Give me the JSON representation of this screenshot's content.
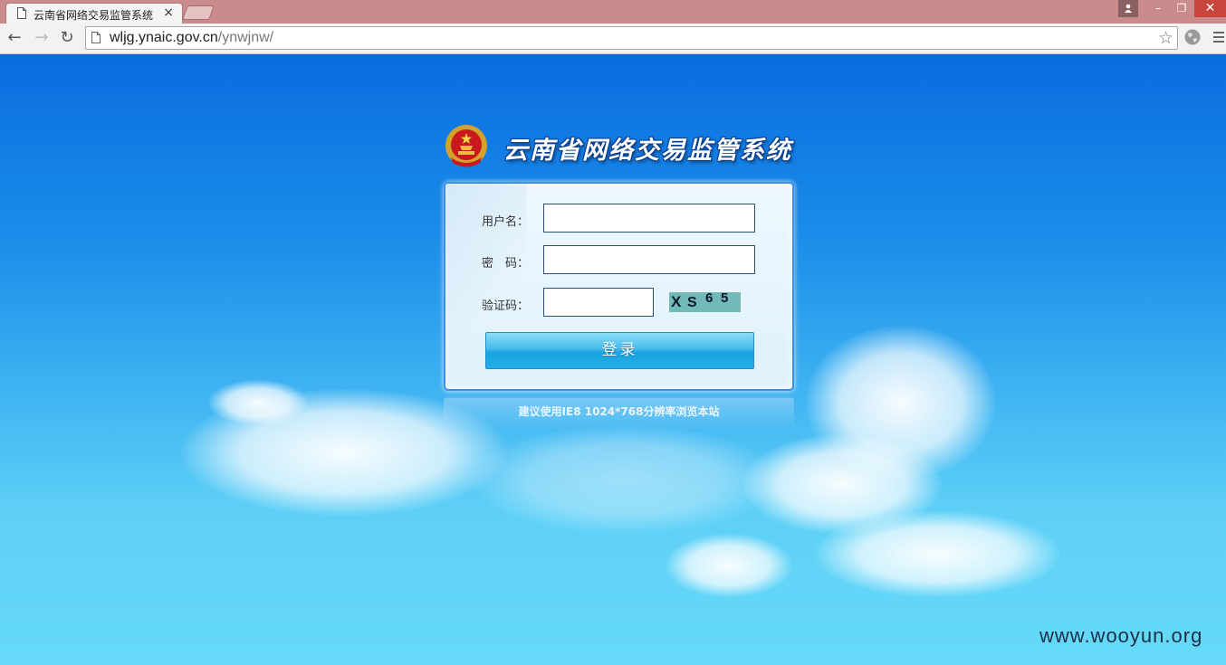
{
  "browser": {
    "tab_title": "云南省网络交易监管系统",
    "tab_close": "×",
    "url_host": "wljg.ynaic.gov.cn",
    "url_path": "/ynwjnw/",
    "window_buttons": {
      "minimize": "–",
      "maximize": "❐",
      "close": "✕"
    },
    "nav": {
      "back": "←",
      "forward": "→",
      "reload": "↻",
      "star": "☆"
    }
  },
  "page": {
    "system_title": "云南省网络交易监管系统",
    "form": {
      "username_label": "用户名：",
      "password_label": "密　码：",
      "captcha_label": "验证码：",
      "username_value": "",
      "password_value": "",
      "captcha_value": "",
      "captcha_chars": [
        "X",
        "S",
        "6",
        "5"
      ]
    },
    "login_button": "登录",
    "browser_tip": "建议使用IE8 1024*768分辨率浏览本站"
  },
  "watermark": "www.wooyun.org",
  "colors": {
    "titlebar": "#c98b8b",
    "page_top": "#0a6cdf",
    "page_bottom": "#66daf8",
    "login_button": "#1aa3e0",
    "captcha_bg": "#72b9b7"
  }
}
